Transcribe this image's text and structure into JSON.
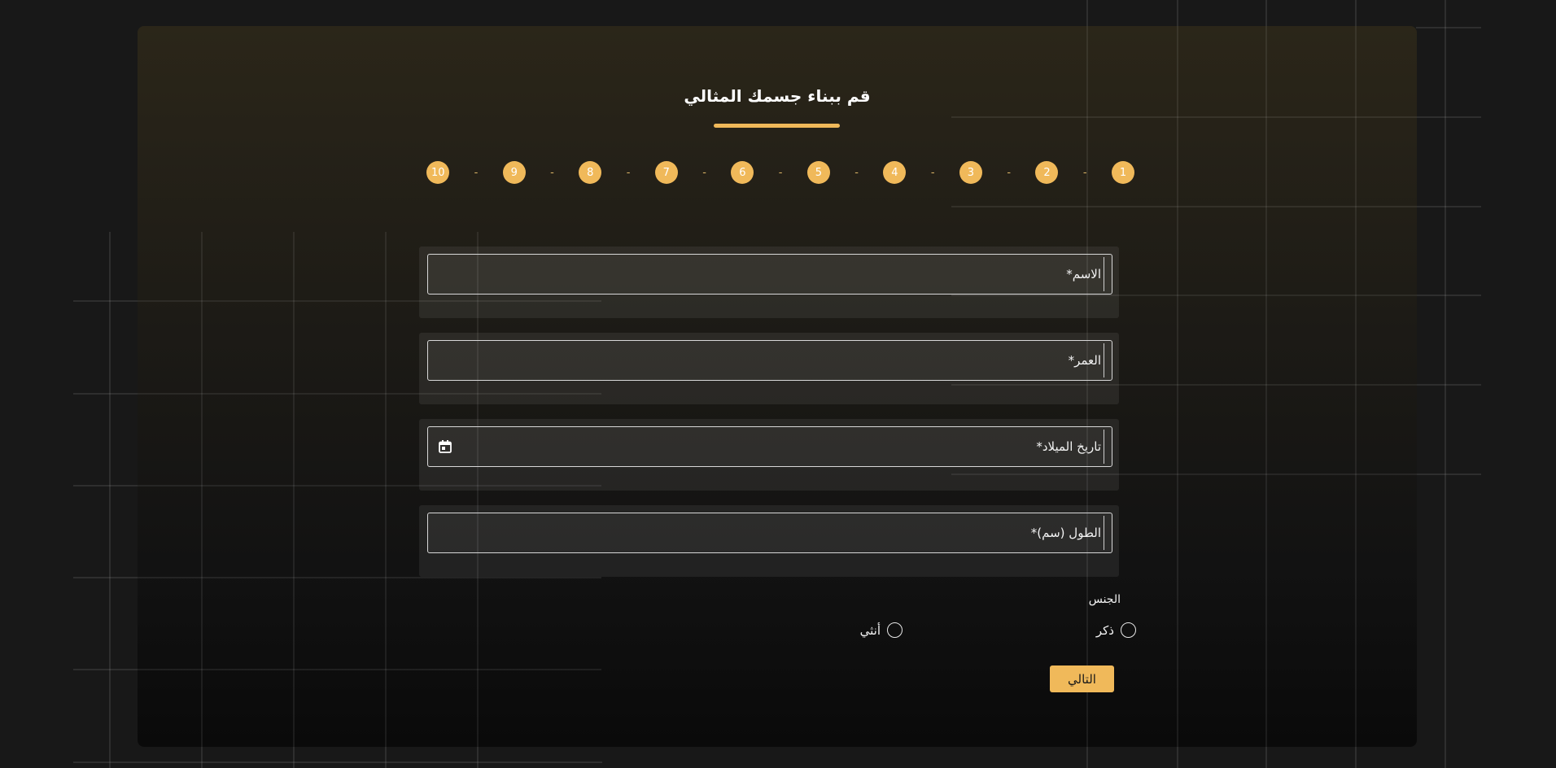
{
  "page": {
    "title": "قم ببناء جسمك المثالي"
  },
  "steps": [
    "1",
    "2",
    "3",
    "4",
    "5",
    "6",
    "7",
    "8",
    "9",
    "10"
  ],
  "step_separator": "-",
  "fields": [
    {
      "label": "الاسم*",
      "icon": ""
    },
    {
      "label": "العمر*",
      "icon": ""
    },
    {
      "label": "تاريخ الميلاد*",
      "icon": "calendar-icon"
    },
    {
      "label": "الطول (سم)*",
      "icon": ""
    }
  ],
  "gender": {
    "title": "الجنس",
    "options": [
      "ذكر",
      "أنثي"
    ]
  },
  "actions": {
    "next_label": "التالي"
  },
  "colors": {
    "accent": "#f0b95a",
    "background": "#181818"
  }
}
